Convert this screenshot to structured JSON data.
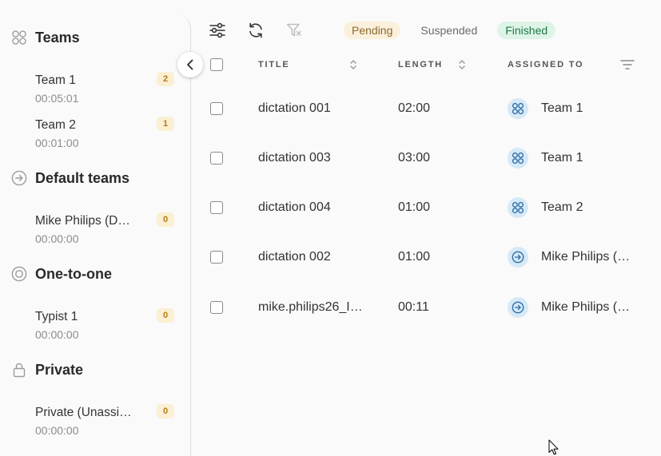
{
  "sidebar": {
    "collapse_icon": "chevron-left-icon",
    "sections": [
      {
        "title": "Teams",
        "icon": "teams-icon",
        "items": [
          {
            "name": "Team 1",
            "time": "00:05:01",
            "count": "2"
          },
          {
            "name": "Team 2",
            "time": "00:01:00",
            "count": "1"
          }
        ]
      },
      {
        "title": "Default teams",
        "icon": "arrow-circle-icon",
        "items": [
          {
            "name": "Mike Philips (D…",
            "time": "00:00:00",
            "count": "0"
          }
        ]
      },
      {
        "title": "One-to-one",
        "icon": "target-icon",
        "items": [
          {
            "name": "Typist 1",
            "time": "00:00:00",
            "count": "0"
          }
        ]
      },
      {
        "title": "Private",
        "icon": "lock-icon",
        "items": [
          {
            "name": "Private (Unassi…",
            "time": "00:00:00",
            "count": "0"
          }
        ]
      }
    ]
  },
  "toolbar": {
    "icons": [
      "sliders-icon",
      "refresh-icon",
      "filter-clear-icon"
    ],
    "status_filters": [
      {
        "label": "Pending",
        "selected": true,
        "bg": "#fbf0dc",
        "color": "#8a6a2f"
      },
      {
        "label": "Suspended",
        "selected": false,
        "bg": "transparent",
        "color": "#6b6b6b"
      },
      {
        "label": "Finished",
        "selected": true,
        "bg": "#ddf4e7",
        "color": "#21784b"
      }
    ]
  },
  "table": {
    "select_all_checked": false,
    "columns": [
      {
        "label": "TITLE",
        "icon": "sort-icon"
      },
      {
        "label": "LENGTH",
        "icon": "sort-icon"
      },
      {
        "label": "ASSIGNED TO",
        "icon": "filter-lines-icon"
      }
    ],
    "rows": [
      {
        "title": "dictation 001",
        "length": "02:00",
        "assignee": "Team 1",
        "assignee_icon": "teams-icon",
        "checked": false
      },
      {
        "title": "dictation 003",
        "length": "03:00",
        "assignee": "Team 1",
        "assignee_icon": "teams-icon",
        "checked": false
      },
      {
        "title": "dictation 004",
        "length": "01:00",
        "assignee": "Team 2",
        "assignee_icon": "teams-icon",
        "checked": false
      },
      {
        "title": "dictation 002",
        "length": "01:00",
        "assignee": "Mike Philips (…",
        "assignee_icon": "arrow-circle-icon",
        "checked": false
      },
      {
        "title": "mike.philips26_I…",
        "length": "00:11",
        "assignee": "Mike Philips (…",
        "assignee_icon": "arrow-circle-icon",
        "checked": false
      }
    ]
  },
  "colors": {
    "background": "#fafafa",
    "border": "#dcdcdc",
    "badge_bg": "#fcefd3",
    "badge_text": "#b27b1a",
    "assignee_icon_bg": "#d6e9f7",
    "assignee_icon_fg": "#2f6da6"
  }
}
